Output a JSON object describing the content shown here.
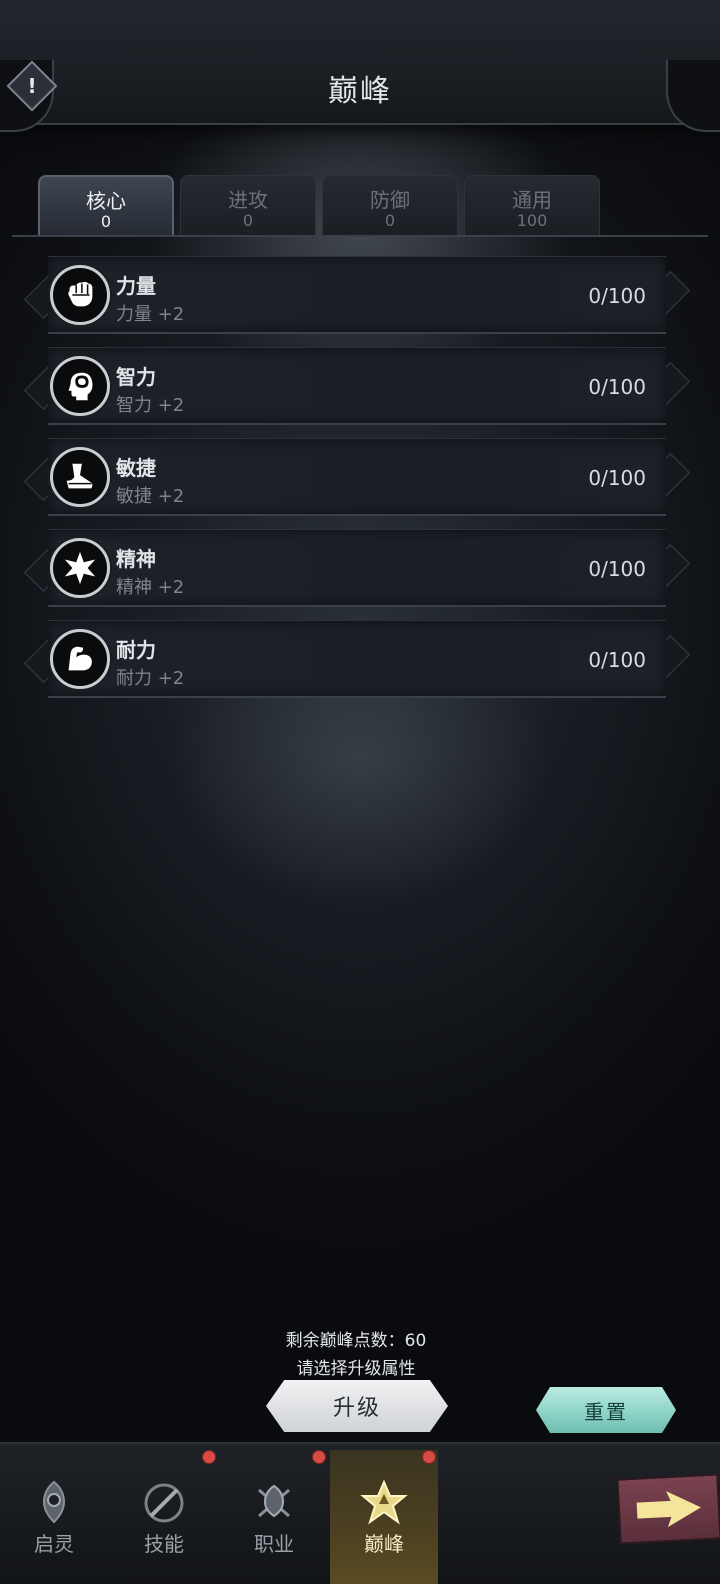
{
  "header": {
    "title": "巅峰",
    "info_icon": "!"
  },
  "tabs": [
    {
      "label": "核心",
      "value": "0"
    },
    {
      "label": "进攻",
      "value": "0"
    },
    {
      "label": "防御",
      "value": "0"
    },
    {
      "label": "通用",
      "value": "100"
    }
  ],
  "attributes": [
    {
      "name": "力量",
      "desc": "力量 +2",
      "value": "0/100",
      "icon": "fist-icon"
    },
    {
      "name": "智力",
      "desc": "智力 +2",
      "value": "0/100",
      "icon": "brain-head-icon"
    },
    {
      "name": "敏捷",
      "desc": "敏捷 +2",
      "value": "0/100",
      "icon": "boot-icon"
    },
    {
      "name": "精神",
      "desc": "精神 +2",
      "value": "0/100",
      "icon": "spirit-burst-icon"
    },
    {
      "name": "耐力",
      "desc": "耐力 +2",
      "value": "0/100",
      "icon": "muscle-arm-icon"
    }
  ],
  "footer": {
    "points_text": "剩余巅峰点数：60",
    "hint_text": "请选择升级属性",
    "upgrade_label": "升级",
    "reset_label": "重置"
  },
  "bottom_nav": [
    {
      "label": "启灵",
      "icon": "spirit-emblem-icon",
      "badge": false
    },
    {
      "label": "技能",
      "icon": "skill-blade-icon",
      "badge": true
    },
    {
      "label": "职业",
      "icon": "class-crest-icon",
      "badge": true
    },
    {
      "label": "巅峰",
      "icon": "pinnacle-star-icon",
      "badge": true,
      "active": true
    }
  ],
  "colors": {
    "accent_teal": "#8fd8ca",
    "badge_red": "#d84a44",
    "active_gold": "#f6ecc4"
  }
}
